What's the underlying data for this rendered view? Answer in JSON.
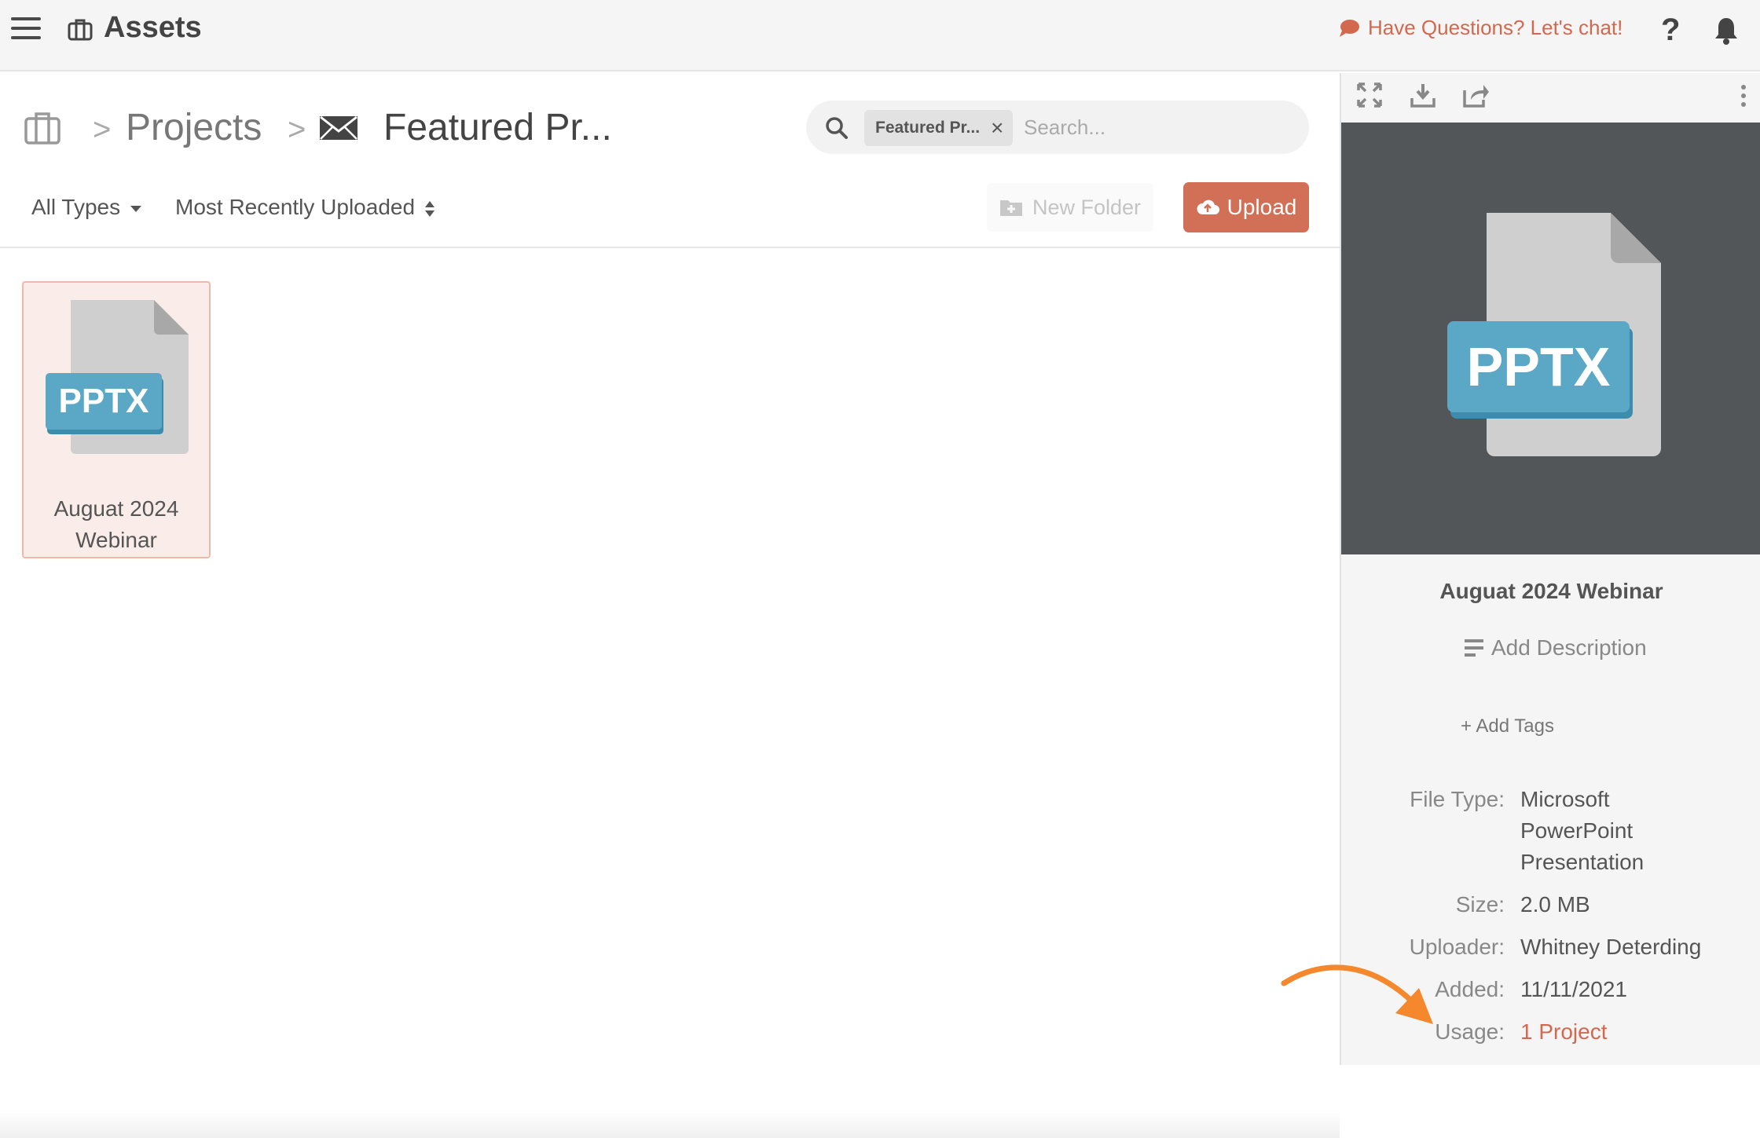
{
  "header": {
    "title": "Assets",
    "chat_label": "Have Questions? Let's chat!",
    "help_label": "?"
  },
  "breadcrumb": {
    "separator": ">",
    "items": [
      {
        "label": "Projects"
      },
      {
        "label": "Featured Pr..."
      }
    ]
  },
  "search": {
    "chip_label": "Featured Pr...",
    "chip_close": "×",
    "placeholder": "Search...",
    "value": ""
  },
  "toolbar": {
    "type_filter": "All Types",
    "sort": "Most Recently Uploaded",
    "new_folder_label": "New Folder",
    "upload_label": "Upload"
  },
  "assets": [
    {
      "name_line1": "Auguat 2024",
      "name_line2": "Webinar",
      "badge": "PPTX"
    }
  ],
  "panel": {
    "preview_badge": "PPTX",
    "title": "Auguat 2024 Webinar",
    "add_description": "Add Description",
    "add_tags": "+ Add Tags",
    "meta": {
      "file_type_label": "File Type:",
      "file_type_lines": [
        "Microsoft",
        "PowerPoint",
        "Presentation"
      ],
      "size_label": "Size:",
      "size_value": "2.0 MB",
      "uploader_label": "Uploader:",
      "uploader_value": "Whitney Deterding",
      "added_label": "Added:",
      "added_value": "11/11/2021",
      "usage_label": "Usage:",
      "usage_value": "1 Project"
    }
  },
  "colors": {
    "accent": "#d2694f",
    "upload_button": "#d27057",
    "preview_background": "#535659",
    "file_badge": "#5aa8c6",
    "annotation_arrow": "#f5872d"
  },
  "icons": {
    "menu": "hamburger-icon",
    "app": "briefcase-icon",
    "chat": "speech-bubble-icon",
    "bell": "bell-icon",
    "search": "magnifier-icon",
    "fullscreen": "expand-icon",
    "download": "download-icon",
    "share": "share-icon",
    "more": "vertical-dots-icon"
  }
}
